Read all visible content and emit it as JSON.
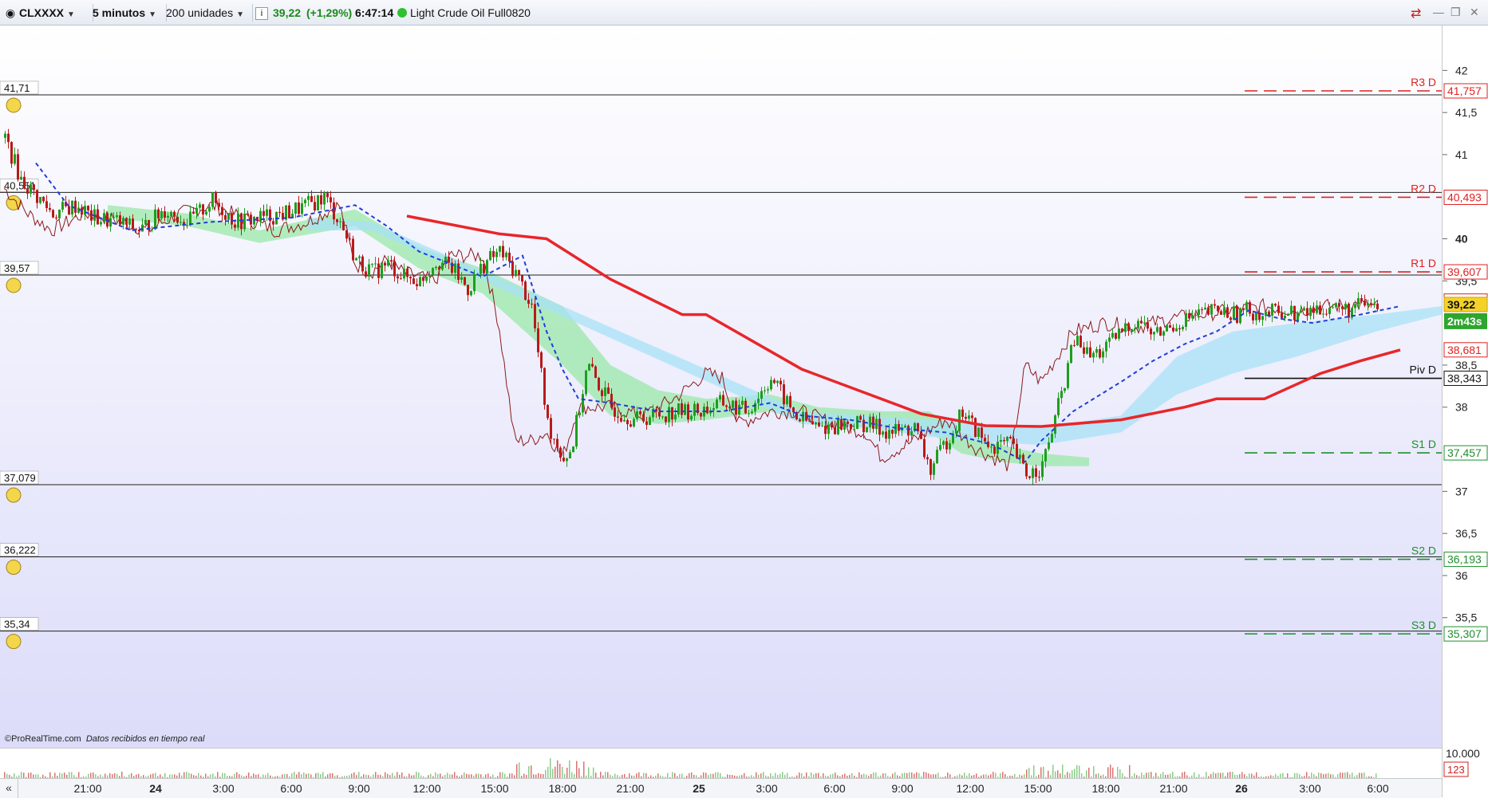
{
  "toolbar": {
    "symbol": "CLXXXX",
    "timeframe": "5 minutos",
    "units": "200 unidades",
    "price": "39,22",
    "change": "(+1,29%)",
    "time": "6:47:14",
    "instrument_name": "Light Crude Oil Full0820"
  },
  "colors": {
    "up": "#1e9e1e",
    "down": "#b81a1a",
    "ma": "#e8262a",
    "tenkan": "#1f3fd6",
    "lagging": "#8b1a1a",
    "cloud_green": "#9ae8a8",
    "cloud_blue": "#a8e2f5",
    "pivot_red": "#e02020",
    "pivot_green": "#1e8f2c"
  },
  "watermark": {
    "brand": "ProRealTime.com",
    "status": "Datos recibidos en tiempo real"
  },
  "countdown": "2m43s",
  "current_price_label": "39,22",
  "alerts": [
    {
      "price": "41,71"
    },
    {
      "price": "40,551"
    },
    {
      "price": "39,57"
    },
    {
      "price": "37,079"
    },
    {
      "price": "36,222"
    },
    {
      "price": "35,34"
    }
  ],
  "pivots": [
    {
      "label": "R3 D",
      "value": "41,757",
      "type": "r"
    },
    {
      "label": "R2 D",
      "value": "40,493",
      "type": "r"
    },
    {
      "label": "R1 D",
      "value": "39,607",
      "type": "r"
    },
    {
      "label": "Piv D",
      "value": "38,343",
      "type": "p"
    },
    {
      "label": "S1 D",
      "value": "37,457",
      "type": "s"
    },
    {
      "label": "S2 D",
      "value": "36,193",
      "type": "s"
    },
    {
      "label": "S3 D",
      "value": "35,307",
      "type": "s"
    }
  ],
  "extra_price_labels": [
    {
      "value": "38,681",
      "color": "#e02020"
    },
    {
      "value": "39,260",
      "color": "#e02020"
    }
  ],
  "volume_axis": {
    "label": "10.000",
    "indicator_value": "123"
  },
  "chart_data": {
    "type": "candlestick",
    "y_ticks": [
      "42",
      "41,5",
      "41",
      "40",
      "39,5",
      "38,5",
      "38",
      "37",
      "36,5",
      "36",
      "35,5"
    ],
    "y_tick_values": [
      42,
      41.5,
      41,
      40,
      39.5,
      38.5,
      38,
      37,
      36.5,
      36,
      35.5
    ],
    "bold_tick": "40",
    "x_labels": [
      "21:00",
      "24",
      "3:00",
      "6:00",
      "9:00",
      "12:00",
      "15:00",
      "18:00",
      "21:00",
      "25",
      "3:00",
      "6:00",
      "9:00",
      "12:00",
      "15:00",
      "18:00",
      "21:00",
      "26",
      "3:00",
      "6:00"
    ],
    "x_label_bold": [
      "24",
      "25",
      "26"
    ],
    "price_path": [
      [
        0,
        41.2
      ],
      [
        20,
        40.7
      ],
      [
        60,
        40.3
      ],
      [
        90,
        40.4
      ],
      [
        110,
        40.25
      ],
      [
        140,
        40.2
      ],
      [
        170,
        40.1
      ],
      [
        200,
        40.35
      ],
      [
        230,
        40.2
      ],
      [
        260,
        40.45
      ],
      [
        290,
        40.2
      ],
      [
        320,
        40.25
      ],
      [
        350,
        40.3
      ],
      [
        380,
        40.4
      ],
      [
        400,
        40.5
      ],
      [
        420,
        40.2
      ],
      [
        440,
        39.75
      ],
      [
        460,
        39.6
      ],
      [
        480,
        39.7
      ],
      [
        500,
        39.55
      ],
      [
        520,
        39.5
      ],
      [
        540,
        39.75
      ],
      [
        560,
        39.65
      ],
      [
        580,
        39.4
      ],
      [
        600,
        39.7
      ],
      [
        620,
        39.85
      ],
      [
        640,
        39.6
      ],
      [
        660,
        39.2
      ],
      [
        680,
        37.8
      ],
      [
        700,
        37.4
      ],
      [
        710,
        37.5
      ],
      [
        730,
        38.5
      ],
      [
        760,
        38.0
      ],
      [
        790,
        37.85
      ],
      [
        810,
        37.9
      ],
      [
        840,
        37.95
      ],
      [
        870,
        37.95
      ],
      [
        900,
        38.05
      ],
      [
        930,
        37.95
      ],
      [
        960,
        38.35
      ],
      [
        990,
        37.9
      ],
      [
        1020,
        37.75
      ],
      [
        1050,
        37.8
      ],
      [
        1080,
        37.8
      ],
      [
        1110,
        37.7
      ],
      [
        1140,
        37.75
      ],
      [
        1160,
        37.25
      ],
      [
        1180,
        37.6
      ],
      [
        1200,
        37.95
      ],
      [
        1230,
        37.55
      ],
      [
        1260,
        37.55
      ],
      [
        1280,
        37.2
      ],
      [
        1300,
        37.3
      ],
      [
        1320,
        38.0
      ],
      [
        1340,
        38.8
      ],
      [
        1360,
        38.6
      ],
      [
        1380,
        38.7
      ],
      [
        1400,
        38.9
      ],
      [
        1420,
        39.05
      ],
      [
        1440,
        38.85
      ],
      [
        1460,
        38.95
      ],
      [
        1480,
        39.05
      ],
      [
        1500,
        39.1
      ],
      [
        1520,
        39.15
      ],
      [
        1540,
        39.1
      ],
      [
        1560,
        39.15
      ],
      [
        1580,
        39.1
      ],
      [
        1600,
        39.15
      ],
      [
        1620,
        39.1
      ],
      [
        1640,
        39.15
      ],
      [
        1660,
        39.2
      ],
      [
        1680,
        39.15
      ],
      [
        1700,
        39.2
      ],
      [
        1720,
        39.22
      ]
    ],
    "moving_average": [
      [
        505,
        40.27
      ],
      [
        620,
        40.06
      ],
      [
        680,
        40.0
      ],
      [
        760,
        39.52
      ],
      [
        850,
        39.1
      ],
      [
        880,
        39.1
      ],
      [
        1000,
        38.45
      ],
      [
        1150,
        37.92
      ],
      [
        1230,
        37.78
      ],
      [
        1300,
        37.77
      ],
      [
        1400,
        37.85
      ],
      [
        1480,
        38.0
      ],
      [
        1520,
        38.1
      ],
      [
        1580,
        38.1
      ],
      [
        1650,
        38.4
      ],
      [
        1700,
        38.55
      ],
      [
        1750,
        38.68
      ]
    ],
    "tenkan": [
      [
        40,
        40.9
      ],
      [
        80,
        40.4
      ],
      [
        160,
        40.1
      ],
      [
        260,
        40.2
      ],
      [
        360,
        40.25
      ],
      [
        440,
        40.4
      ],
      [
        480,
        40.15
      ],
      [
        520,
        39.85
      ],
      [
        560,
        39.7
      ],
      [
        600,
        39.55
      ],
      [
        650,
        39.8
      ],
      [
        680,
        38.9
      ],
      [
        700,
        38.45
      ],
      [
        720,
        38.1
      ],
      [
        760,
        38.05
      ],
      [
        820,
        37.95
      ],
      [
        900,
        37.95
      ],
      [
        960,
        38.05
      ],
      [
        1000,
        37.9
      ],
      [
        1060,
        37.85
      ],
      [
        1120,
        37.75
      ],
      [
        1180,
        37.7
      ],
      [
        1240,
        37.55
      ],
      [
        1280,
        37.35
      ],
      [
        1300,
        37.6
      ],
      [
        1340,
        37.95
      ],
      [
        1400,
        38.3
      ],
      [
        1440,
        38.55
      ],
      [
        1480,
        38.75
      ],
      [
        1520,
        38.9
      ],
      [
        1560,
        39.15
      ],
      [
        1600,
        39.05
      ],
      [
        1640,
        39.0
      ],
      [
        1700,
        39.1
      ],
      [
        1750,
        39.2
      ]
    ],
    "lagging": [
      [
        0,
        40.6
      ],
      [
        30,
        40.3
      ],
      [
        60,
        40.1
      ],
      [
        100,
        40.3
      ],
      [
        130,
        40.25
      ],
      [
        180,
        40.1
      ],
      [
        220,
        40.3
      ],
      [
        260,
        40.4
      ],
      [
        300,
        40.25
      ],
      [
        340,
        40.1
      ],
      [
        380,
        40.2
      ],
      [
        420,
        40.4
      ],
      [
        440,
        39.7
      ],
      [
        460,
        39.6
      ],
      [
        480,
        39.75
      ],
      [
        500,
        39.6
      ],
      [
        540,
        39.5
      ],
      [
        560,
        39.8
      ],
      [
        600,
        39.8
      ],
      [
        620,
        39.0
      ],
      [
        640,
        37.6
      ],
      [
        660,
        37.6
      ],
      [
        680,
        37.7
      ],
      [
        700,
        37.4
      ],
      [
        720,
        38.0
      ],
      [
        760,
        38.0
      ],
      [
        800,
        37.9
      ],
      [
        840,
        38.1
      ],
      [
        880,
        38.4
      ],
      [
        900,
        38.35
      ],
      [
        920,
        37.8
      ],
      [
        960,
        37.95
      ],
      [
        1000,
        37.95
      ],
      [
        1040,
        37.8
      ],
      [
        1080,
        37.7
      ],
      [
        1100,
        37.4
      ],
      [
        1140,
        37.6
      ],
      [
        1180,
        37.85
      ],
      [
        1220,
        37.5
      ],
      [
        1260,
        37.3
      ],
      [
        1280,
        38.5
      ],
      [
        1300,
        38.3
      ],
      [
        1340,
        38.9
      ],
      [
        1380,
        39.0
      ],
      [
        1420,
        38.95
      ],
      [
        1460,
        39.05
      ],
      [
        1500,
        39.1
      ],
      [
        1540,
        39.15
      ],
      [
        1580,
        39.2
      ],
      [
        1620,
        39.15
      ],
      [
        1660,
        39.2
      ],
      [
        1700,
        39.22
      ],
      [
        1720,
        39.2
      ]
    ]
  }
}
